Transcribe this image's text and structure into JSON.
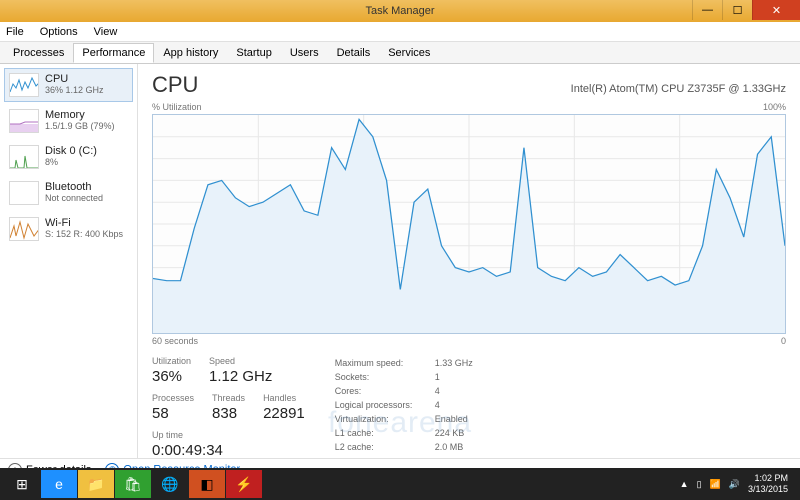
{
  "window": {
    "title": "Task Manager"
  },
  "menu": {
    "file": "File",
    "options": "Options",
    "view": "View"
  },
  "tabs": [
    {
      "label": "Processes"
    },
    {
      "label": "Performance",
      "active": true
    },
    {
      "label": "App history"
    },
    {
      "label": "Startup"
    },
    {
      "label": "Users"
    },
    {
      "label": "Details"
    },
    {
      "label": "Services"
    }
  ],
  "sidebar": [
    {
      "name": "CPU",
      "value": "36%  1.12 GHz",
      "selected": true,
      "icon": "cpu-mini"
    },
    {
      "name": "Memory",
      "value": "1.5/1.9 GB (79%)",
      "icon": "mem-mini"
    },
    {
      "name": "Disk 0 (C:)",
      "value": "8%",
      "icon": "disk-mini"
    },
    {
      "name": "Bluetooth",
      "value": "Not connected",
      "icon": "bt-mini"
    },
    {
      "name": "Wi-Fi",
      "value": "S: 152  R: 400 Kbps",
      "icon": "wifi-mini"
    }
  ],
  "header": {
    "title": "CPU",
    "cpu_name": "Intel(R) Atom(TM) CPU Z3735F @ 1.33GHz",
    "util_label": "% Utilization",
    "max_label": "100%",
    "time_label": "60 seconds",
    "zero_label": "0"
  },
  "stats": {
    "utilization": {
      "label": "Utilization",
      "value": "36%"
    },
    "speed": {
      "label": "Speed",
      "value": "1.12 GHz"
    },
    "processes": {
      "label": "Processes",
      "value": "58"
    },
    "threads": {
      "label": "Threads",
      "value": "838"
    },
    "handles": {
      "label": "Handles",
      "value": "22891"
    },
    "uptime": {
      "label": "Up time",
      "value": "0:00:49:34"
    },
    "details": {
      "max_speed": {
        "k": "Maximum speed:",
        "v": "1.33 GHz"
      },
      "sockets": {
        "k": "Sockets:",
        "v": "1"
      },
      "cores": {
        "k": "Cores:",
        "v": "4"
      },
      "lprocs": {
        "k": "Logical processors:",
        "v": "4"
      },
      "virt": {
        "k": "Virtualization:",
        "v": "Enabled"
      },
      "l1": {
        "k": "L1 cache:",
        "v": "224 KB"
      },
      "l2": {
        "k": "L2 cache:",
        "v": "2.0 MB"
      }
    }
  },
  "bottom": {
    "fewer": "Fewer details",
    "resmon": "Open Resource Monitor"
  },
  "tray": {
    "time": "1:02 PM",
    "date": "3/13/2015"
  },
  "watermark": "fonearena",
  "chart_data": {
    "type": "line",
    "title": "CPU % Utilization",
    "ylabel": "% Utilization",
    "xlabel": "seconds",
    "xlim": [
      60,
      0
    ],
    "ylim": [
      0,
      100
    ],
    "values": [
      25,
      24,
      24,
      48,
      68,
      70,
      62,
      58,
      60,
      64,
      68,
      56,
      54,
      85,
      75,
      98,
      90,
      70,
      20,
      60,
      66,
      40,
      30,
      28,
      30,
      26,
      28,
      85,
      30,
      26,
      24,
      30,
      26,
      28,
      36,
      30,
      24,
      26,
      22,
      24,
      40,
      75,
      62,
      44,
      82,
      90,
      40
    ]
  }
}
